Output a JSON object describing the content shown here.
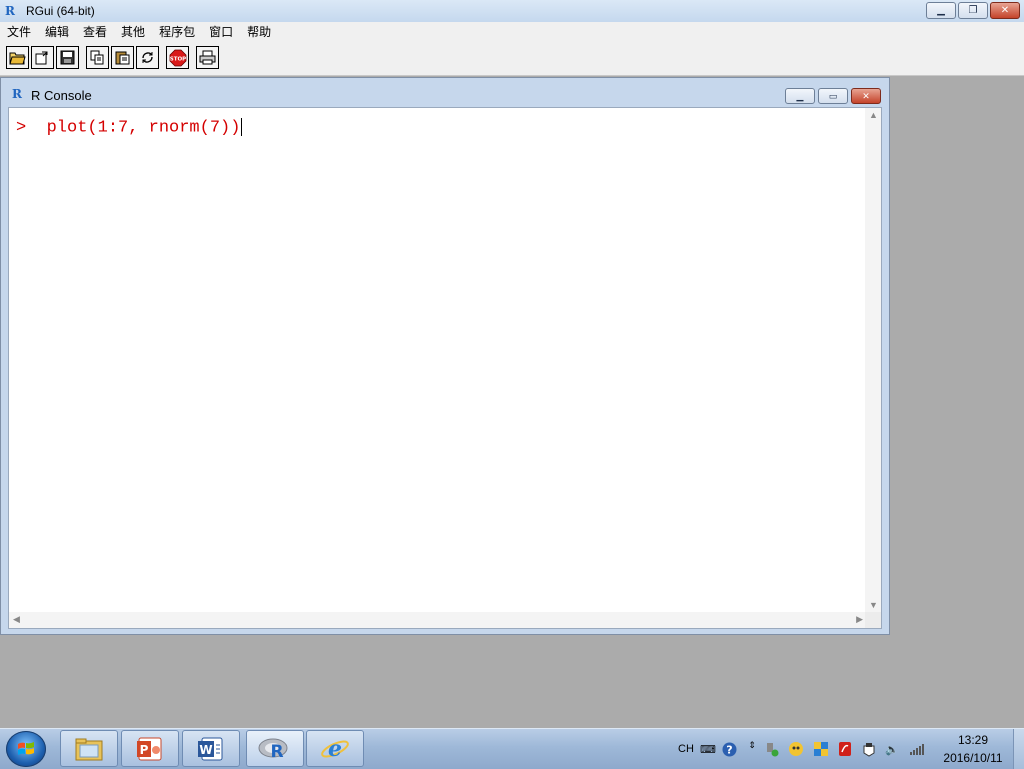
{
  "app": {
    "title": "RGui (64-bit)",
    "logo": "R"
  },
  "menu": [
    "文件",
    "编辑",
    "查看",
    "其他",
    "程序包",
    "窗口",
    "帮助"
  ],
  "toolbar": {
    "buttons": [
      "open-script-icon",
      "load-workspace-icon",
      "save-workspace-icon",
      "copy-icon",
      "paste-icon",
      "copy-paste-icon",
      "stop-icon",
      "print-icon"
    ],
    "stop_label": "STOP"
  },
  "console": {
    "title": "R Console",
    "prompt": ">",
    "command": "plot(1:7, rnorm(7))"
  },
  "taskbar": {
    "apps": [
      "file-explorer",
      "powerpoint",
      "word",
      "r-gui",
      "internet-explorer"
    ],
    "word_letter": "W",
    "ppt_letter": "P",
    "r_letter": "R",
    "ie_letter": "e"
  },
  "tray": {
    "language": "CH",
    "time": "13:29",
    "date": "2016/10/11"
  },
  "colors": {
    "command_text": "#d40000",
    "titlebar": "#c5d8ee",
    "taskbar": "#9eb8d8",
    "desktop_bg": "#ababab"
  }
}
